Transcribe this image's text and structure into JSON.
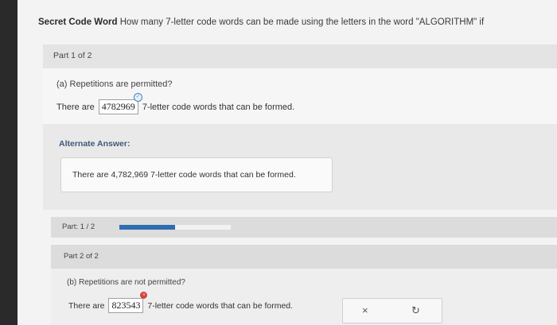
{
  "question": {
    "title": "Secret Code Word",
    "text": "How many 7-letter code words can be made using the letters in the word \"ALGORITHM\" if"
  },
  "part1": {
    "header": "Part 1 of 2",
    "subquestion": "(a) Repetitions are permitted?",
    "answer_prefix": "There are",
    "answer_value": "4782969",
    "answer_suffix": "7-letter code words that can be formed."
  },
  "alternate": {
    "title": "Alternate Answer:",
    "text": "There are 4,782,969 7-letter code words that can be formed."
  },
  "progress": {
    "label": "Part: 1 / 2",
    "fraction": 0.5,
    "fill_color": "#2f6db0"
  },
  "part2": {
    "header": "Part 2 of 2",
    "subquestion": "(b) Repetitions are not permitted?",
    "answer_prefix": "There are",
    "answer_value": "823543",
    "answer_suffix": "7-letter code words that can be formed.",
    "clear_icon": "×",
    "retry_icon": "↻"
  }
}
